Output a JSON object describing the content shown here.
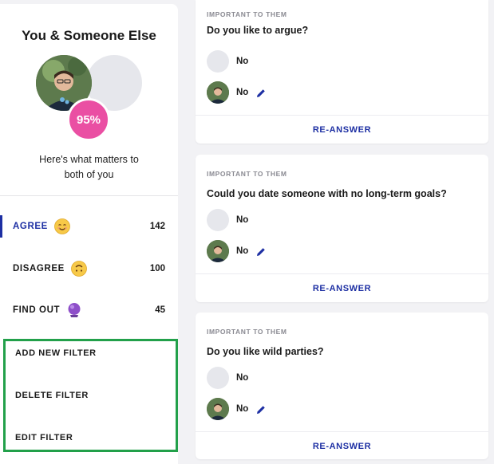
{
  "sidebar": {
    "title": "You & Someone Else",
    "match_percent": "95%",
    "subtitle": "Here's what matters to both of you",
    "categories": [
      {
        "label": "AGREE",
        "count": "142",
        "emoji": "smiling-face-icon"
      },
      {
        "label": "DISAGREE",
        "count": "100",
        "emoji": "upside-down-face-icon"
      },
      {
        "label": "FIND OUT",
        "count": "45",
        "emoji": "crystal-ball-icon"
      }
    ],
    "filters": [
      "ADD NEW FILTER",
      "DELETE FILTER",
      "EDIT FILTER"
    ]
  },
  "questions": [
    {
      "tag": "IMPORTANT TO THEM",
      "question": "Do you like to argue?",
      "their_answer": "No",
      "your_answer": "No",
      "action": "RE-ANSWER"
    },
    {
      "tag": "IMPORTANT TO THEM",
      "question": "Could you date someone with no long-term goals?",
      "their_answer": "No",
      "your_answer": "No",
      "action": "RE-ANSWER"
    },
    {
      "tag": "IMPORTANT TO THEM",
      "question": "Do you like wild parties?",
      "their_answer": "No",
      "your_answer": "No",
      "action": "RE-ANSWER"
    }
  ],
  "colors": {
    "accent": "#1d2fa3",
    "match_badge": "#ea4fa3",
    "filter_outline": "#22a04a"
  }
}
